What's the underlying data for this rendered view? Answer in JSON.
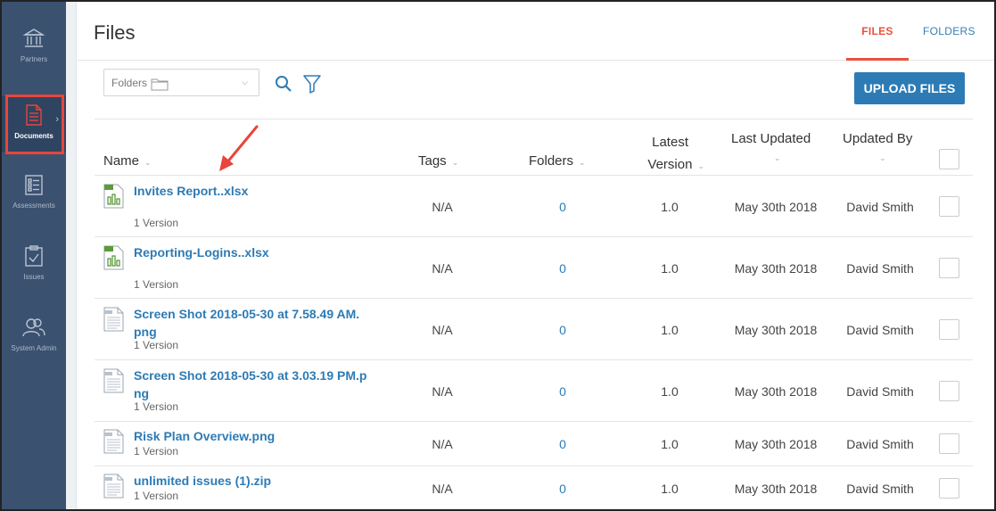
{
  "sidebar": {
    "items": [
      {
        "label": "Partners",
        "icon": "bank-icon"
      },
      {
        "label": "Documents",
        "icon": "document-icon"
      },
      {
        "label": "Assessments",
        "icon": "checklist-icon"
      },
      {
        "label": "Issues",
        "icon": "clipboard-check-icon"
      },
      {
        "label": "System Admin",
        "icon": "users-icon"
      }
    ],
    "active": "Documents"
  },
  "header": {
    "title": "Files",
    "tabs": [
      {
        "label": "FILES",
        "active": true
      },
      {
        "label": "FOLDERS",
        "active": false
      }
    ]
  },
  "toolbar": {
    "folder_select_label": "Folders",
    "upload_label": "UPLOAD FILES"
  },
  "table": {
    "columns": {
      "name": "Name",
      "tags": "Tags",
      "folders": "Folders",
      "latest_version_line1": "Latest",
      "latest_version_line2": "Version",
      "last_updated": "Last Updated",
      "updated_by": "Updated By"
    },
    "rows": [
      {
        "name": "Invites Report..xlsx",
        "name_line2": "",
        "versions": "1 Version",
        "tags": "N/A",
        "folders": "0",
        "version": "1.0",
        "updated": "May 30th 2018",
        "by": "David Smith",
        "type": "spreadsheet"
      },
      {
        "name": "Reporting-Logins..xlsx",
        "name_line2": "",
        "versions": "1 Version",
        "tags": "N/A",
        "folders": "0",
        "version": "1.0",
        "updated": "May 30th 2018",
        "by": "David Smith",
        "type": "spreadsheet"
      },
      {
        "name": "Screen Shot 2018-05-30 at 7.58.49 AM.",
        "name_line2": "png",
        "versions": "1 Version",
        "tags": "N/A",
        "folders": "0",
        "version": "1.0",
        "updated": "May 30th 2018",
        "by": "David Smith",
        "type": "document"
      },
      {
        "name": "Screen Shot 2018-05-30 at 3.03.19 PM.p",
        "name_line2": "ng",
        "versions": "1 Version",
        "tags": "N/A",
        "folders": "0",
        "version": "1.0",
        "updated": "May 30th 2018",
        "by": "David Smith",
        "type": "document"
      },
      {
        "name": "Risk Plan Overview.png",
        "name_line2": "",
        "versions": "1 Version",
        "tags": "N/A",
        "folders": "0",
        "version": "1.0",
        "updated": "May 30th 2018",
        "by": "David Smith",
        "type": "document"
      },
      {
        "name": "unlimited issues (1).zip",
        "name_line2": "",
        "versions": "1 Version",
        "tags": "N/A",
        "folders": "0",
        "version": "1.0",
        "updated": "May 30th 2018",
        "by": "David Smith",
        "type": "document"
      }
    ]
  },
  "colors": {
    "sidebar": "#3a5170",
    "accent_red": "#e8523e",
    "link_blue": "#2d7bb5",
    "highlight_box": "#e8453c"
  }
}
